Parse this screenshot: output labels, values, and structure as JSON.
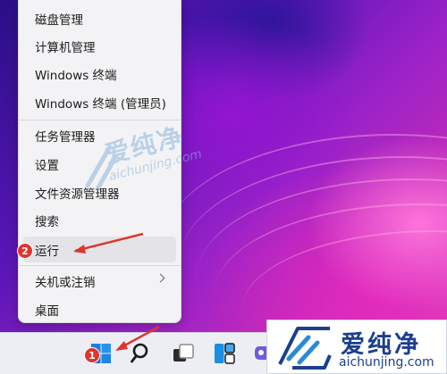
{
  "menu": {
    "items": [
      {
        "label": "磁盘管理"
      },
      {
        "label": "计算机管理"
      },
      {
        "label": "Windows 终端"
      },
      {
        "label": "Windows 终端 (管理员)"
      },
      {
        "label": "任务管理器"
      },
      {
        "label": "设置"
      },
      {
        "label": "文件资源管理器"
      },
      {
        "label": "搜索"
      },
      {
        "label": "运行"
      },
      {
        "label": "关机或注销"
      },
      {
        "label": "桌面"
      }
    ]
  },
  "annotations": {
    "step1": "1",
    "step2": "2",
    "arrow_color": "#e0352c"
  },
  "taskbar": {
    "icons": [
      "windows-start-icon",
      "search-icon",
      "task-view-icon",
      "widgets-icon",
      "chat-icon"
    ]
  },
  "watermark": {
    "brand": "爱纯净",
    "url": "aichunjing.com"
  },
  "logo": {
    "brand": "爱纯净",
    "url": "aichunjing.com"
  }
}
